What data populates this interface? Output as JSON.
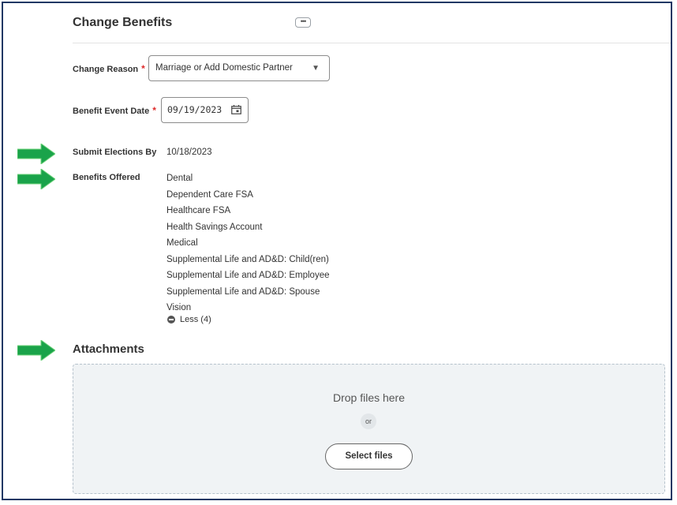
{
  "header": {
    "title": "Change Benefits",
    "more_label": "•••"
  },
  "form": {
    "change_reason": {
      "label": "Change Reason",
      "required_mark": "*",
      "value": "Marriage or Add Domestic Partner",
      "caret": "▼"
    },
    "benefit_event_date": {
      "label": "Benefit Event Date",
      "required_mark": "*",
      "value": "09/19/2023"
    },
    "submit_elections_by": {
      "label": "Submit Elections By",
      "value": "10/18/2023"
    },
    "benefits_offered": {
      "label": "Benefits Offered",
      "items": [
        "Dental",
        "Dependent Care FSA",
        "Healthcare FSA",
        "Health Savings Account",
        "Medical",
        "Supplemental Life and AD&D: Child(ren)",
        "Supplemental Life and AD&D: Employee",
        "Supplemental Life and AD&D: Spouse",
        "Vision"
      ],
      "less_label": "Less (4)"
    }
  },
  "attachments": {
    "title": "Attachments",
    "drop_text": "Drop files here",
    "or_text": "or",
    "select_button": "Select files"
  },
  "colors": {
    "arrow": "#1aa34a",
    "required": "#de2b2b",
    "frame_border": "#1f3864"
  },
  "icons": {
    "calendar": "calendar-icon",
    "arrow": "green-arrow-icon",
    "less": "minus-circle-icon"
  }
}
